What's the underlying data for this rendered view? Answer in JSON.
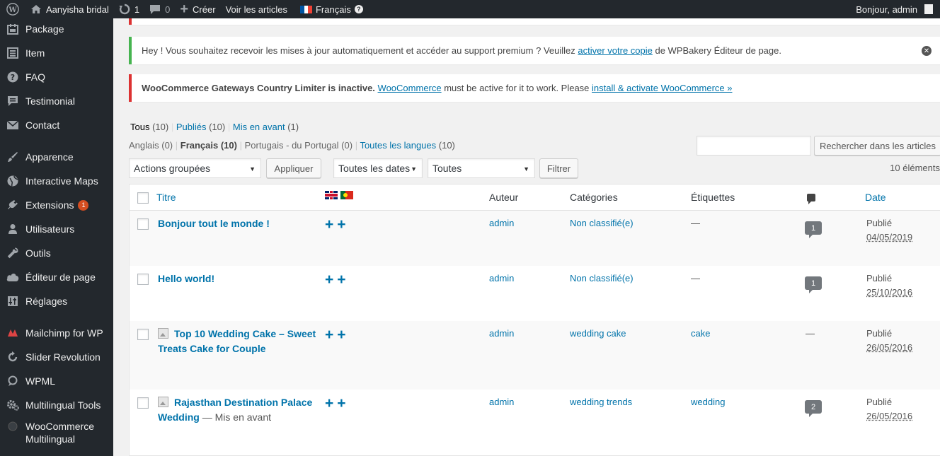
{
  "adminbar": {
    "site_name": "Aanyisha bridal",
    "updates_count": "1",
    "comments_count": "0",
    "new_label": "Créer",
    "view_posts_label": "Voir les articles",
    "language_label": "Français",
    "greeting": "Bonjour, admin"
  },
  "sidebar": {
    "items": [
      {
        "label": "Package",
        "icon": "calendar-icon"
      },
      {
        "label": "Item",
        "icon": "list-icon"
      },
      {
        "label": "FAQ",
        "icon": "question-icon"
      },
      {
        "label": "Testimonial",
        "icon": "quote-icon"
      },
      {
        "label": "Contact",
        "icon": "mail-icon"
      },
      {
        "label": "Apparence",
        "icon": "brush-icon"
      },
      {
        "label": "Interactive Maps",
        "icon": "globe-icon"
      },
      {
        "label": "Extensions",
        "icon": "plugin-icon",
        "badge": "1"
      },
      {
        "label": "Utilisateurs",
        "icon": "user-icon"
      },
      {
        "label": "Outils",
        "icon": "wrench-icon"
      },
      {
        "label": "Éditeur de page",
        "icon": "cloud-icon"
      },
      {
        "label": "Réglages",
        "icon": "sliders-icon"
      },
      {
        "label": "Mailchimp for WP",
        "icon": "mailchimp-icon"
      },
      {
        "label": "Slider Revolution",
        "icon": "refresh-icon"
      },
      {
        "label": "WPML",
        "icon": "wpml-icon"
      },
      {
        "label": "Multilingual Tools",
        "icon": "gear-icon"
      },
      {
        "label": "WooCommerce Multilingual",
        "icon": "circle-icon"
      }
    ]
  },
  "notices": {
    "wpbakery": {
      "text_before": "Hey ! Vous souhaitez recevoir les mises à jour automatiquement et accéder au support premium ? Veuillez ",
      "link": "activer votre copie",
      "text_after": " de WPBakery Éditeur de page."
    },
    "woo": {
      "strong": "WooCommerce Gateways Country Limiter is inactive.",
      "link1": "WooCommerce",
      "middle": " must be active for it to work. Please ",
      "link2": "install & activate WooCommerce »"
    }
  },
  "views": {
    "all": "Tous",
    "all_count": "(10)",
    "published": "Publiés",
    "published_count": "(10)",
    "sticky": "Mis en avant",
    "sticky_count": "(1)"
  },
  "languages": {
    "en": "Anglais (0)",
    "fr": "Français (10)",
    "pt": "Portugais - du Portugal (0)",
    "all_link": "Toutes les langues",
    "all_count": "(10)"
  },
  "search": {
    "button": "Rechercher dans les articles",
    "value": ""
  },
  "filters": {
    "bulk_actions": "Actions groupées",
    "apply": "Appliquer",
    "dates": "Toutes les dates",
    "categories": "Toutes",
    "filter": "Filtrer",
    "items_count": "10 éléments"
  },
  "table": {
    "headers": {
      "title": "Titre",
      "author": "Auteur",
      "categories": "Catégories",
      "tags": "Étiquettes",
      "date": "Date"
    },
    "rows": [
      {
        "title": "Bonjour tout le monde !",
        "title_line2": "",
        "state": "",
        "author": "admin",
        "category": "Non classifié(e)",
        "tags": "—",
        "comments": "1",
        "status": "Publié",
        "date": "04/05/2019"
      },
      {
        "title": "Hello world!",
        "title_line2": "",
        "state": "",
        "author": "admin",
        "category": "Non classifié(e)",
        "tags": "—",
        "comments": "1",
        "status": "Publié",
        "date": "25/10/2016"
      },
      {
        "title": "Top 10 Wedding Cake – Sweet",
        "title_line2": "Treats Cake for Couple",
        "state": "",
        "author": "admin",
        "category": "wedding cake",
        "tags": "cake",
        "comments": "—",
        "status": "Publié",
        "date": "26/05/2016"
      },
      {
        "title": "Rajasthan Destination Palace",
        "title_line2": "Wedding",
        "state": " — Mis en avant",
        "author": "admin",
        "category": "wedding trends",
        "tags": "wedding",
        "comments": "2",
        "status": "Publié",
        "date": "26/05/2016"
      }
    ],
    "translate_plus": "++"
  },
  "colors": {
    "adminbar_bg": "#23282d",
    "link": "#0073aa",
    "notice_success": "#46b450",
    "notice_error": "#dc3232",
    "badge": "#d54e21"
  }
}
